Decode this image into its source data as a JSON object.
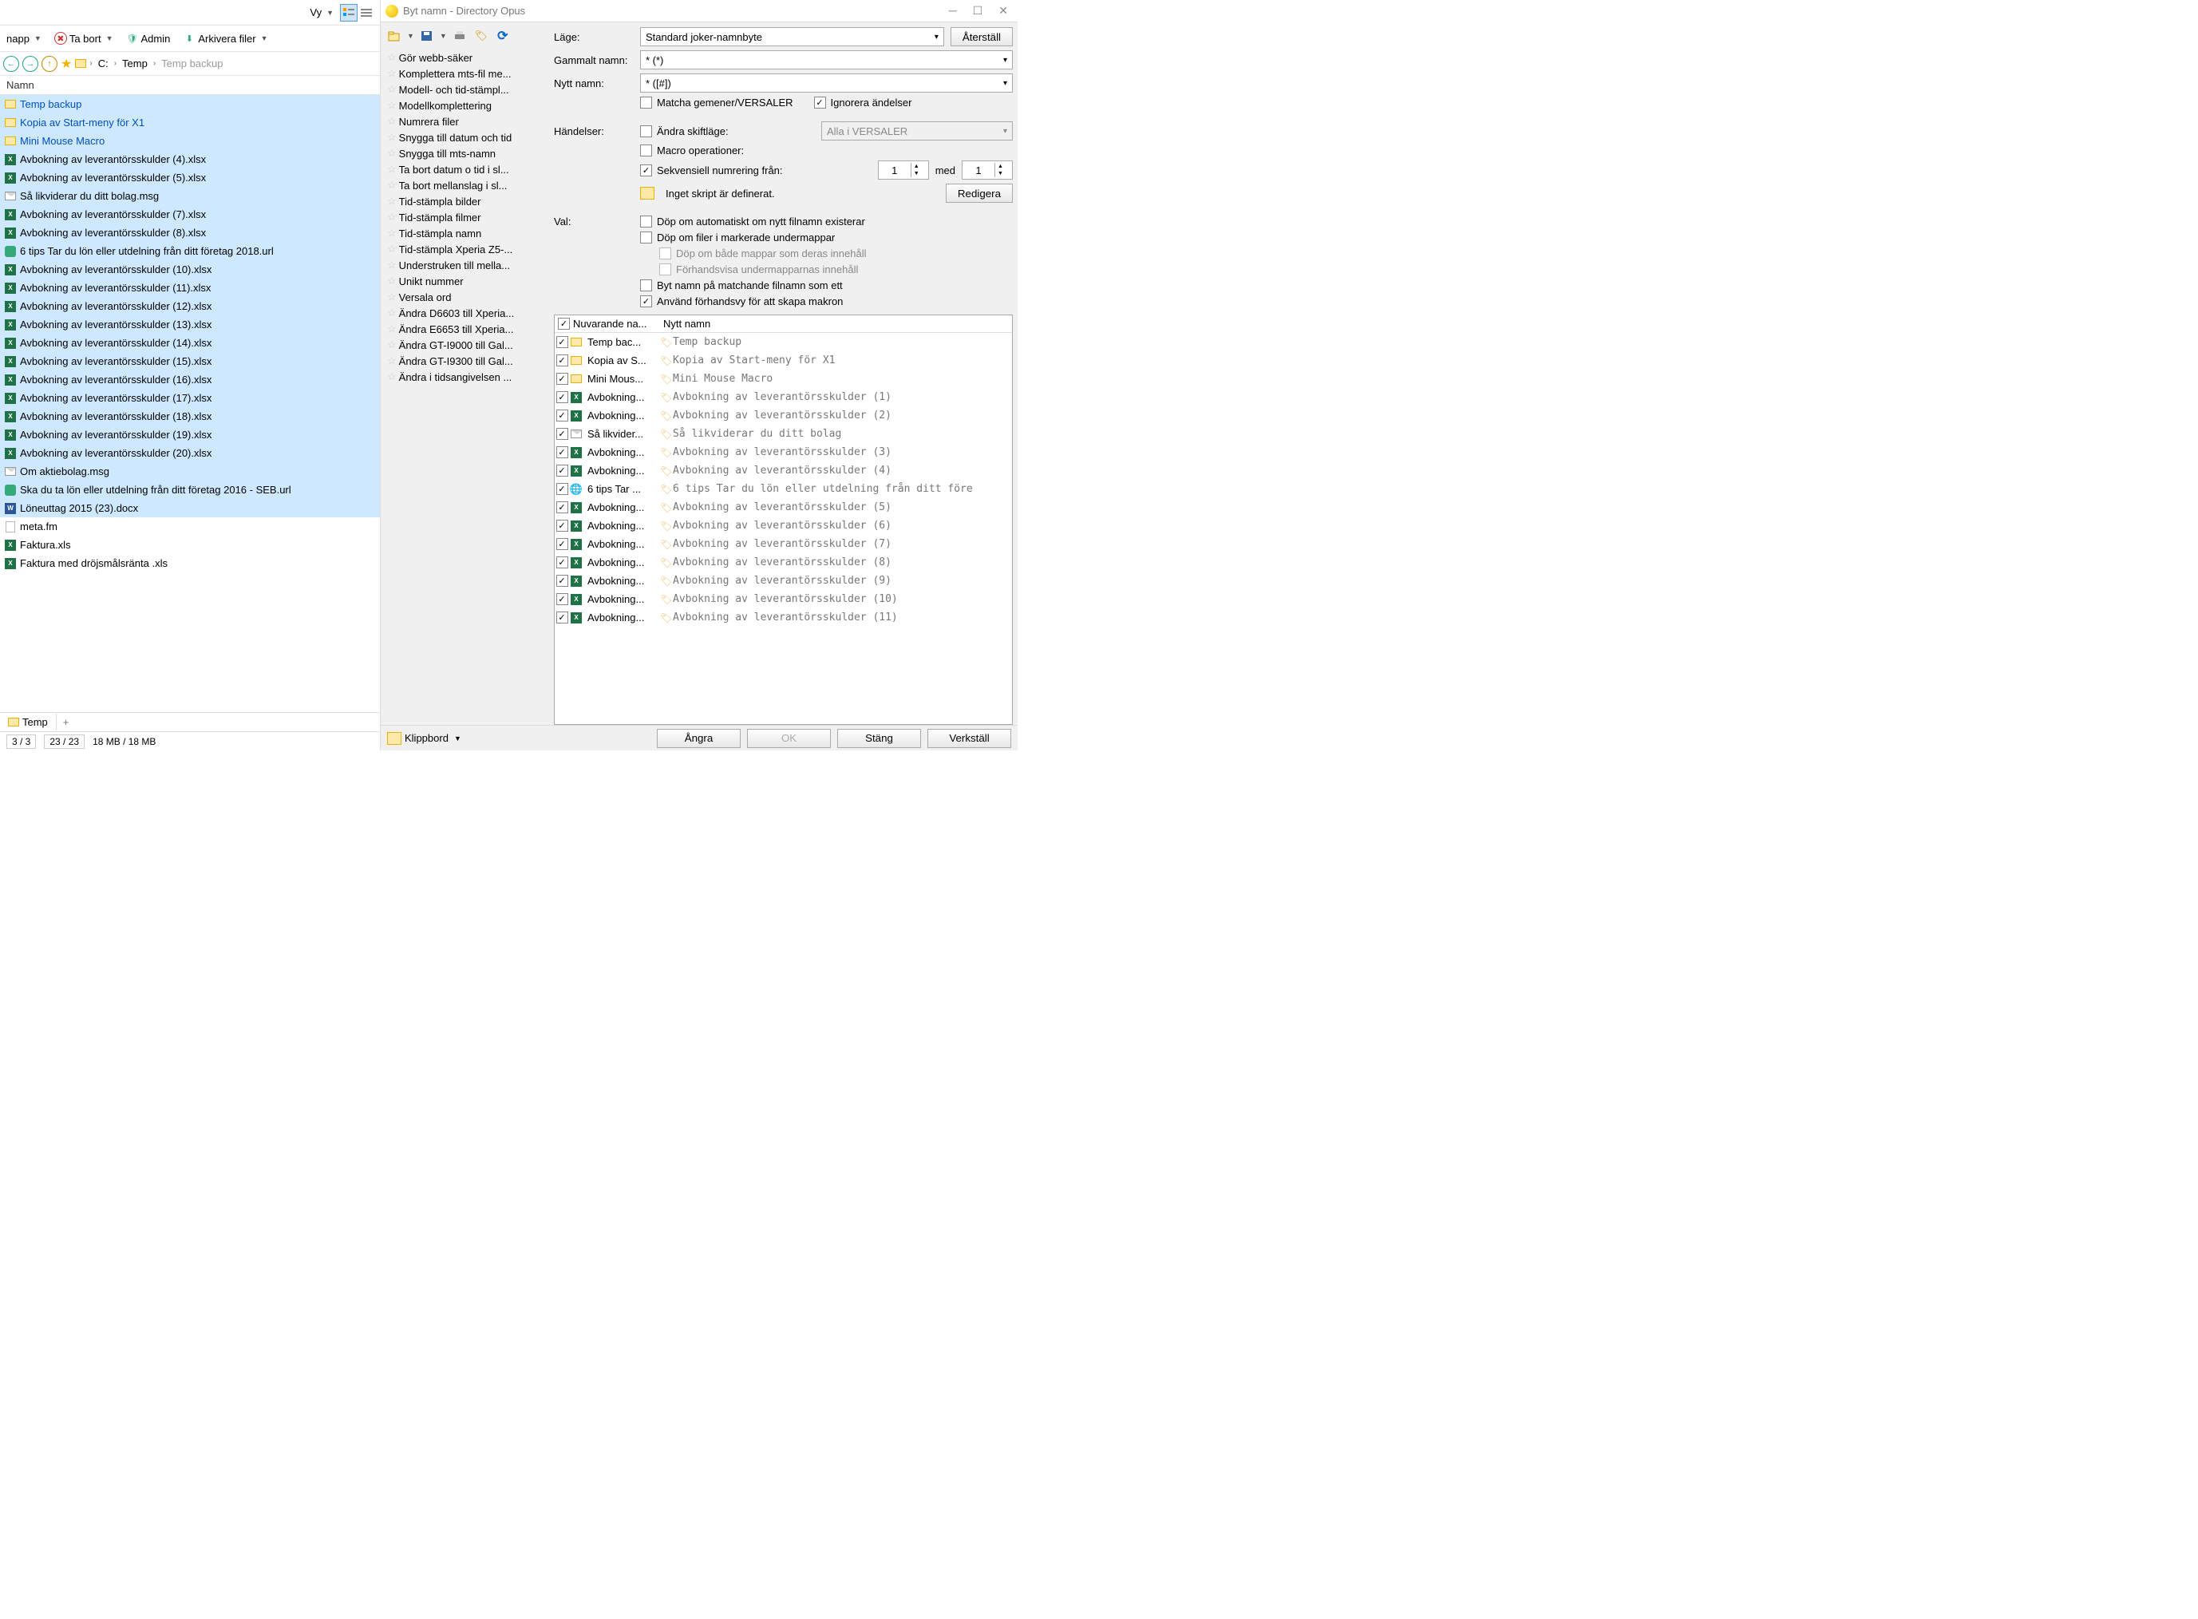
{
  "left": {
    "vy_label": "Vy",
    "tb2": {
      "napp": "napp",
      "tabort": "Ta bort",
      "admin": "Admin",
      "arkivera": "Arkivera filer"
    },
    "bc": {
      "c": "C:",
      "temp": "Temp",
      "grey": "Temp backup"
    },
    "col_name": "Namn",
    "files": [
      {
        "t": "folder",
        "n": "Temp backup",
        "sel": true,
        "blue": true
      },
      {
        "t": "folder",
        "n": "Kopia av Start-meny för X1",
        "sel": true,
        "blue": true
      },
      {
        "t": "folder",
        "n": "Mini Mouse Macro",
        "sel": true,
        "blue": true
      },
      {
        "t": "xl",
        "n": "Avbokning av leverantörsskulder (4).xlsx",
        "sel": true
      },
      {
        "t": "xl",
        "n": "Avbokning av leverantörsskulder (5).xlsx",
        "sel": true
      },
      {
        "t": "msg",
        "n": "Så likviderar du ditt bolag.msg",
        "sel": true
      },
      {
        "t": "xl",
        "n": "Avbokning av leverantörsskulder (7).xlsx",
        "sel": true
      },
      {
        "t": "xl",
        "n": "Avbokning av leverantörsskulder (8).xlsx",
        "sel": true
      },
      {
        "t": "url",
        "n": "6 tips Tar du lön eller utdelning från ditt företag 2018.url",
        "sel": true
      },
      {
        "t": "xl",
        "n": "Avbokning av leverantörsskulder (10).xlsx",
        "sel": true
      },
      {
        "t": "xl",
        "n": "Avbokning av leverantörsskulder (11).xlsx",
        "sel": true
      },
      {
        "t": "xl",
        "n": "Avbokning av leverantörsskulder (12).xlsx",
        "sel": true
      },
      {
        "t": "xl",
        "n": "Avbokning av leverantörsskulder (13).xlsx",
        "sel": true
      },
      {
        "t": "xl",
        "n": "Avbokning av leverantörsskulder (14).xlsx",
        "sel": true
      },
      {
        "t": "xl",
        "n": "Avbokning av leverantörsskulder (15).xlsx",
        "sel": true
      },
      {
        "t": "xl",
        "n": "Avbokning av leverantörsskulder (16).xlsx",
        "sel": true
      },
      {
        "t": "xl",
        "n": "Avbokning av leverantörsskulder (17).xlsx",
        "sel": true
      },
      {
        "t": "xl",
        "n": "Avbokning av leverantörsskulder (18).xlsx",
        "sel": true
      },
      {
        "t": "xl",
        "n": "Avbokning av leverantörsskulder (19).xlsx",
        "sel": true
      },
      {
        "t": "xl",
        "n": "Avbokning av leverantörsskulder (20).xlsx",
        "sel": true
      },
      {
        "t": "msg",
        "n": "Om aktiebolag.msg",
        "sel": true
      },
      {
        "t": "url",
        "n": "Ska du ta lön eller utdelning från ditt företag 2016 - SEB.url",
        "sel": true
      },
      {
        "t": "doc",
        "n": "Löneuttag 2015 (23).docx",
        "sel": true
      },
      {
        "t": "gen",
        "n": "meta.fm",
        "sel": false
      },
      {
        "t": "xl",
        "n": "Faktura.xls",
        "sel": false
      },
      {
        "t": "xl",
        "n": "Faktura med dröjsmålsränta .xls",
        "sel": false
      }
    ],
    "bottom_tab": "Temp",
    "status": {
      "a": "3 / 3",
      "b": "23 / 23",
      "c": "18 MB / 18 MB"
    }
  },
  "dialog": {
    "title": "Byt namn - Directory Opus",
    "presets": [
      "Gör webb-säker",
      "Komplettera mts-fil me...",
      "Modell- och tid-stämpl...",
      "Modellkomplettering",
      "Numrera filer",
      "Snygga till datum och tid",
      "Snygga till mts-namn",
      "Ta bort datum o tid i sl...",
      "Ta bort mellanslag i sl...",
      "Tid-stämpla bilder",
      "Tid-stämpla filmer",
      "Tid-stämpla namn",
      "Tid-stämpla Xperia Z5-...",
      "Understruken till mella...",
      "Unikt nummer",
      "Versala ord",
      "Ändra D6603 till Xperia...",
      "Ändra E6653 till Xperia...",
      "Ändra GT-I9000 till Gal...",
      "Ändra GT-I9300 till Gal...",
      "Ändra i tidsangivelsen ..."
    ],
    "lbl_mode": "Läge:",
    "mode_val": "Standard joker-namnbyte",
    "btn_reset": "Återställ",
    "lbl_old": "Gammalt namn:",
    "old_val": "* (*)",
    "lbl_new": "Nytt namn:",
    "new_val": "* ([#])",
    "chk_case": "Matcha gemener/VERSALER",
    "chk_ext": "Ignorera ändelser",
    "lbl_events": "Händelser:",
    "chk_changecase": "Ändra skiftläge:",
    "combo_case": "Alla i VERSALER",
    "chk_macro": "Macro operationer:",
    "chk_seq": "Sekvensiell numrering från:",
    "seq_v1": "1",
    "lbl_med": "med",
    "seq_v2": "1",
    "script_none": "Inget skript är definerat.",
    "btn_edit": "Redigera",
    "lbl_opts": "Val:",
    "chk_auto": "Döp om automatiskt om nytt  filnamn existerar",
    "chk_sub": "Döp om  filer i markerade undermappar",
    "chk_both": "Döp om både mappar som deras innehåll",
    "chk_prevsub": "Förhandsvisa undermapparnas innehåll",
    "chk_one": "Byt namn på matchande filnamn som ett",
    "chk_macroprev": "Använd förhandsvy för att skapa makron",
    "pv_h1": "Nuvarande na...",
    "pv_h2": "Nytt namn",
    "preview": [
      {
        "t": "folder",
        "o": "Temp bac...",
        "n": "Temp backup"
      },
      {
        "t": "folder",
        "o": "Kopia av S...",
        "n": "Kopia av Start-meny för X1"
      },
      {
        "t": "folder",
        "o": "Mini Mous...",
        "n": "Mini Mouse Macro"
      },
      {
        "t": "xl",
        "o": "Avbokning...",
        "n": "Avbokning av leverantörsskulder (1)"
      },
      {
        "t": "xl",
        "o": "Avbokning...",
        "n": "Avbokning av leverantörsskulder (2)"
      },
      {
        "t": "msg",
        "o": "Så likvider...",
        "n": "Så likviderar du ditt bolag"
      },
      {
        "t": "xl",
        "o": "Avbokning...",
        "n": "Avbokning av leverantörsskulder (3)"
      },
      {
        "t": "xl",
        "o": "Avbokning...",
        "n": "Avbokning av leverantörsskulder (4)"
      },
      {
        "t": "globe",
        "o": "6 tips Tar ...",
        "n": "6 tips Tar du lön eller utdelning från ditt före"
      },
      {
        "t": "xl",
        "o": "Avbokning...",
        "n": "Avbokning av leverantörsskulder (5)"
      },
      {
        "t": "xl",
        "o": "Avbokning...",
        "n": "Avbokning av leverantörsskulder (6)"
      },
      {
        "t": "xl",
        "o": "Avbokning...",
        "n": "Avbokning av leverantörsskulder (7)"
      },
      {
        "t": "xl",
        "o": "Avbokning...",
        "n": "Avbokning av leverantörsskulder (8)"
      },
      {
        "t": "xl",
        "o": "Avbokning...",
        "n": "Avbokning av leverantörsskulder (9)"
      },
      {
        "t": "xl",
        "o": "Avbokning...",
        "n": "Avbokning av leverantörsskulder (10)"
      },
      {
        "t": "xl",
        "o": "Avbokning...",
        "n": "Avbokning av leverantörsskulder (11)"
      }
    ],
    "footer": {
      "klipp": "Klippbord",
      "undo": "Ångra",
      "ok": "OK",
      "close": "Stäng",
      "apply": "Verkställ"
    }
  }
}
